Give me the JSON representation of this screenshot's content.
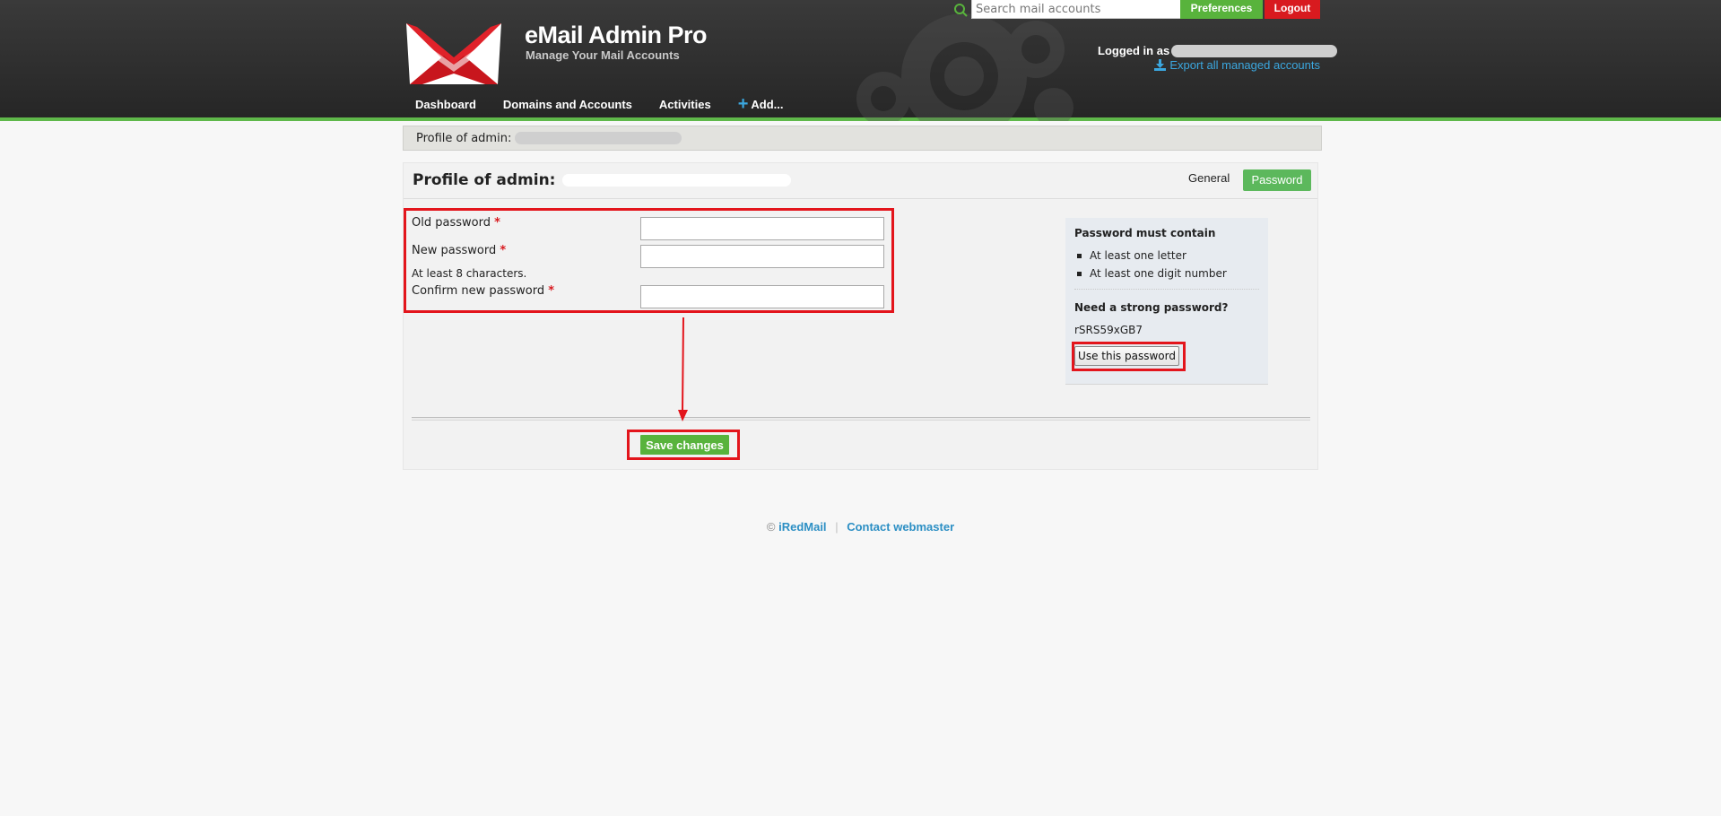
{
  "header": {
    "app_title": "eMail Admin Pro",
    "app_subtitle": "Manage Your Mail Accounts",
    "search_placeholder": "Search mail accounts",
    "preferences_label": "Preferences",
    "logout_label": "Logout",
    "logged_in_label": "Logged in as",
    "export_label": "Export all managed accounts"
  },
  "nav": {
    "items": [
      {
        "label": "Dashboard"
      },
      {
        "label": "Domains and Accounts"
      },
      {
        "label": "Activities"
      },
      {
        "label": "Add..."
      }
    ]
  },
  "breadcrumb": {
    "label": "Profile of admin:"
  },
  "profile": {
    "title": "Profile of admin:",
    "tabs": {
      "general": "General",
      "password": "Password"
    }
  },
  "form": {
    "old_password_label": "Old password",
    "new_password_label": "New password",
    "new_password_hint": "At least 8 characters.",
    "confirm_password_label": "Confirm new password",
    "required_mark": "*",
    "save_label": "Save changes"
  },
  "sidebar": {
    "title": "Password must contain",
    "rules": [
      "At least one letter",
      "At least one digit number"
    ],
    "strong_title": "Need a strong password?",
    "generated_password": "rSRS59xGB7",
    "use_button_label": "Use this password"
  },
  "footer": {
    "copyright": "©",
    "brand_link": "iRedMail",
    "separator": "|",
    "contact_link": "Contact webmaster"
  },
  "colors": {
    "accent_green": "#58b33c",
    "logout_red": "#d81a1f",
    "link_blue": "#3ba7df",
    "highlight_red": "#e3151c"
  }
}
